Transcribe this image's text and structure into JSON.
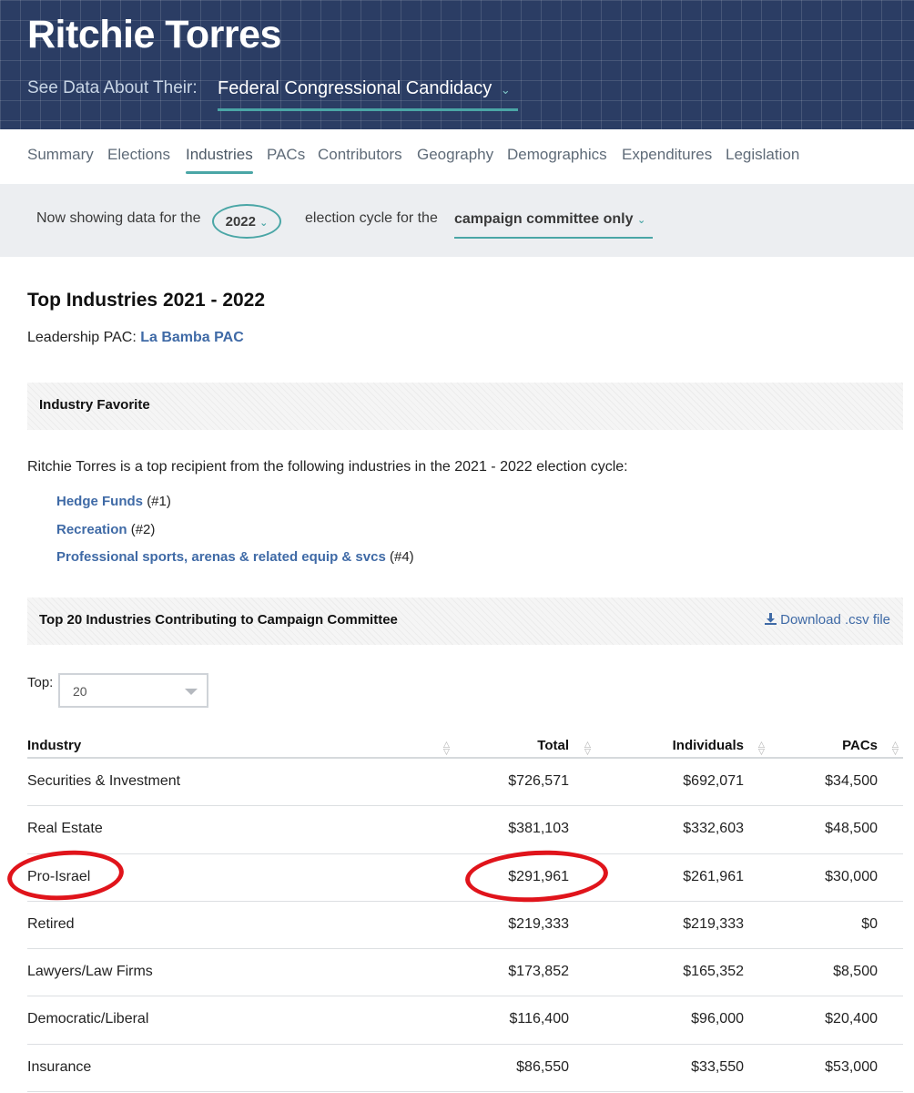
{
  "header": {
    "name": "Ritchie Torres",
    "see_label": "See Data About Their:",
    "candidacy_select": "Federal Congressional Candidacy"
  },
  "tabs": [
    {
      "label": "Summary"
    },
    {
      "label": "Elections"
    },
    {
      "label": "Industries",
      "active": true
    },
    {
      "label": "PACs"
    },
    {
      "label": "Contributors"
    },
    {
      "label": "Geography"
    },
    {
      "label": "Demographics"
    },
    {
      "label": "Expenditures"
    },
    {
      "label": "Legislation"
    }
  ],
  "cycle_bar": {
    "prefix": "Now showing data for the",
    "year": "2022",
    "middle": "election cycle for the",
    "committee": "campaign committee only"
  },
  "main": {
    "title": "Top Industries 2021 - 2022",
    "leadership_label": "Leadership PAC:",
    "leadership_pac": "La Bamba PAC",
    "favorite_header": "Industry Favorite",
    "recipient_text": "Ritchie Torres is a top recipient from the following industries in the 2021 - 2022 election cycle:",
    "favorites": [
      {
        "name": "Hedge Funds",
        "rank": "(#1)"
      },
      {
        "name": "Recreation",
        "rank": "(#2)"
      },
      {
        "name": "Professional sports, arenas & related equip & svcs",
        "rank": "(#4)"
      }
    ],
    "top20_header": "Top 20 Industries Contributing to Campaign Committee",
    "download_label": "Download .csv file",
    "top_label": "Top:",
    "top_value": "20"
  },
  "table": {
    "headers": {
      "industry": "Industry",
      "total": "Total",
      "individuals": "Individuals",
      "pacs": "PACs"
    },
    "rows": [
      {
        "industry": "Securities & Investment",
        "total": "$726,571",
        "individuals": "$692,071",
        "pacs": "$34,500"
      },
      {
        "industry": "Real Estate",
        "total": "$381,103",
        "individuals": "$332,603",
        "pacs": "$48,500"
      },
      {
        "industry": "Pro-Israel",
        "total": "$291,961",
        "individuals": "$261,961",
        "pacs": "$30,000"
      },
      {
        "industry": "Retired",
        "total": "$219,333",
        "individuals": "$219,333",
        "pacs": "$0"
      },
      {
        "industry": "Lawyers/Law Firms",
        "total": "$173,852",
        "individuals": "$165,352",
        "pacs": "$8,500"
      },
      {
        "industry": "Democratic/Liberal",
        "total": "$116,400",
        "individuals": "$96,000",
        "pacs": "$20,400"
      },
      {
        "industry": "Insurance",
        "total": "$86,550",
        "individuals": "$33,550",
        "pacs": "$53,000"
      }
    ]
  },
  "colors": {
    "header_bg": "#2b3d64",
    "accent_teal": "#4aa6a6",
    "link_blue": "#3f6aa6",
    "annotation_red": "#e0141b"
  }
}
